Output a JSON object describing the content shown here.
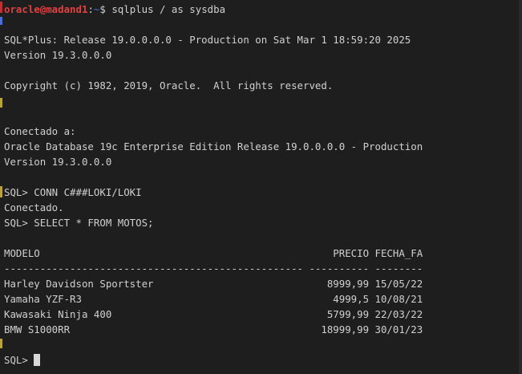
{
  "prompt": {
    "user_host": "oracle@madand1",
    "path": "~",
    "separator": ":",
    "symbol": "$",
    "command": "sqlplus / as sysdba"
  },
  "lines": {
    "banner1": "SQL*Plus: Release 19.0.0.0.0 - Production on Sat Mar 1 18:59:20 2025",
    "banner2": "Version 19.3.0.0.0",
    "copyright": "Copyright (c) 1982, 2019, Oracle.  All rights reserved.",
    "connected_to": "Conectado a:",
    "db_edition": "Oracle Database 19c Enterprise Edition Release 19.0.0.0.0 - Production",
    "db_version": "Version 19.3.0.0.0",
    "conn_cmd": "SQL> CONN C###LOKI/LOKI",
    "conn_result": "Conectado.",
    "select_cmd": "SQL> SELECT * FROM MOTOS;",
    "final_prompt": "SQL> "
  },
  "table": {
    "headers": [
      "MODELO",
      "PRECIO",
      "FECHA_FA"
    ],
    "separator": "-------------------------------------------------- ---------- --------",
    "rows": [
      [
        "Harley Davidson Sportster",
        "8999,99",
        "15/05/22"
      ],
      [
        "Yamaha YZF-R3",
        "4999,5",
        "10/08/21"
      ],
      [
        "Kawasaki Ninja 400",
        "5799,99",
        "22/03/22"
      ],
      [
        "BMW S1000RR",
        "18999,99",
        "30/01/23"
      ]
    ]
  },
  "colors": {
    "background": "#1e1e1e",
    "text": "#d0d0d0",
    "prompt_user": "#e04040",
    "prompt_path": "#4a6fd8"
  }
}
